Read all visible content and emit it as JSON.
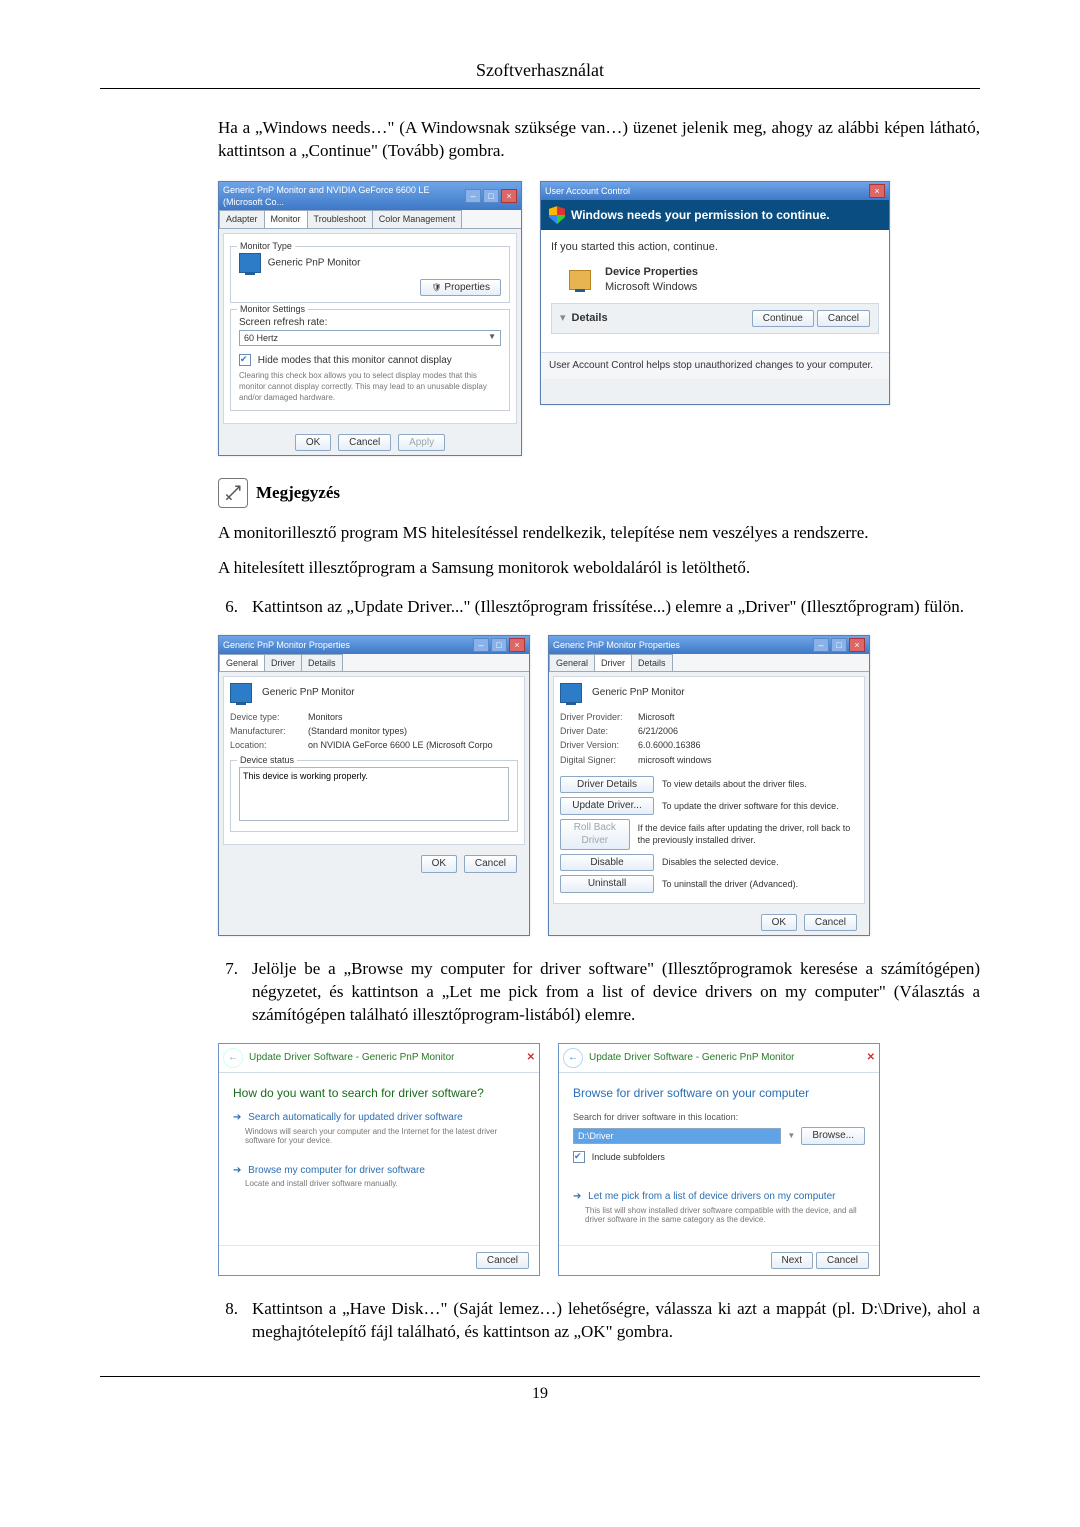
{
  "header": {
    "title": "Szoftverhasználat"
  },
  "intro": {
    "p1": "Ha a „Windows needs…\" (A Windowsnak szüksége van…) üzenet jelenik meg, ahogy az alábbi képen látható, kattintson a „Continue\" (Tovább) gombra."
  },
  "monitor_dialog": {
    "title": "Generic PnP Monitor and NVIDIA GeForce 6600 LE (Microsoft Co...",
    "tabs": [
      "Adapter",
      "Monitor",
      "Troubleshoot",
      "Color Management"
    ],
    "group1": "Monitor Type",
    "monitor_name": "Generic PnP Monitor",
    "properties_btn": "Properties",
    "group2": "Monitor Settings",
    "refresh_label": "Screen refresh rate:",
    "refresh_value": "60 Hertz",
    "hide_modes_chk": "Hide modes that this monitor cannot display",
    "hide_modes_desc": "Clearing this check box allows you to select display modes that this monitor cannot display correctly. This may lead to an unusable display and/or damaged hardware.",
    "ok": "OK",
    "cancel": "Cancel",
    "apply": "Apply"
  },
  "uac": {
    "title": "User Account Control",
    "headline": "Windows needs your permission to continue.",
    "if_started": "If you started this action, continue.",
    "app": "Device Properties",
    "publisher": "Microsoft Windows",
    "details": "Details",
    "continue": "Continue",
    "cancel": "Cancel",
    "footer": "User Account Control helps stop unauthorized changes to your computer."
  },
  "note": {
    "label": "Megjegyzés",
    "p1": "A monitorillesztő program MS hitelesítéssel rendelkezik, telepítése nem veszélyes a rendszerre.",
    "p2": "A hitelesített illesztőprogram a Samsung monitorok weboldaláról is letölthető."
  },
  "step6": {
    "num": "6.",
    "text": "Kattintson az „Update Driver...\" (Illesztőprogram frissítése...) elemre a „Driver\" (Illesztőprogram) fülön."
  },
  "prop_general": {
    "title": "Generic PnP Monitor Properties",
    "tabs": [
      "General",
      "Driver",
      "Details"
    ],
    "monitor_name": "Generic PnP Monitor",
    "device_type_k": "Device type:",
    "device_type_v": "Monitors",
    "manufacturer_k": "Manufacturer:",
    "manufacturer_v": "(Standard monitor types)",
    "location_k": "Location:",
    "location_v": "on NVIDIA GeForce 6600 LE (Microsoft Corpo",
    "status_cap": "Device status",
    "status_text": "This device is working properly.",
    "ok": "OK",
    "cancel": "Cancel"
  },
  "prop_driver": {
    "title": "Generic PnP Monitor Properties",
    "tabs": [
      "General",
      "Driver",
      "Details"
    ],
    "monitor_name": "Generic PnP Monitor",
    "provider_k": "Driver Provider:",
    "provider_v": "Microsoft",
    "date_k": "Driver Date:",
    "date_v": "6/21/2006",
    "version_k": "Driver Version:",
    "version_v": "6.0.6000.16386",
    "signer_k": "Digital Signer:",
    "signer_v": "microsoft windows",
    "btn_details": "Driver Details",
    "btn_details_d": "To view details about the driver files.",
    "btn_update": "Update Driver...",
    "btn_update_d": "To update the driver software for this device.",
    "btn_rollback": "Roll Back Driver",
    "btn_rollback_d": "If the device fails after updating the driver, roll back to the previously installed driver.",
    "btn_disable": "Disable",
    "btn_disable_d": "Disables the selected device.",
    "btn_uninstall": "Uninstall",
    "btn_uninstall_d": "To uninstall the driver (Advanced).",
    "ok": "OK",
    "cancel": "Cancel"
  },
  "step7": {
    "num": "7.",
    "text": "Jelölje be a „Browse my computer for driver software\" (Illesztőprogramok keresése a számítógépen) négyzetet, és kattintson a „Let me pick from a list of device drivers on my computer\" (Választás a számítógépen található illesztőprogram-listából) elemre."
  },
  "wiz1": {
    "crumb": "Update Driver Software - Generic PnP Monitor",
    "heading": "How do you want to search for driver software?",
    "opt1": "Search automatically for updated driver software",
    "opt1_sub": "Windows will search your computer and the Internet for the latest driver software for your device.",
    "opt2": "Browse my computer for driver software",
    "opt2_sub": "Locate and install driver software manually.",
    "cancel": "Cancel"
  },
  "wiz2": {
    "crumb": "Update Driver Software - Generic PnP Monitor",
    "heading": "Browse for driver software on your computer",
    "path_label": "Search for driver software in this location:",
    "path_value": "D:\\Driver",
    "browse": "Browse...",
    "include": "Include subfolders",
    "opt": "Let me pick from a list of device drivers on my computer",
    "opt_sub": "This list will show installed driver software compatible with the device, and all driver software in the same category as the device.",
    "next": "Next",
    "cancel": "Cancel"
  },
  "step8": {
    "num": "8.",
    "text": "Kattintson a „Have Disk…\" (Saját lemez…) lehetőségre, válassza ki azt a mappát (pl. D:\\Drive), ahol a meghajtótelepítő fájl található, és kattintson az „OK\" gombra."
  },
  "footer": {
    "page": "19"
  }
}
